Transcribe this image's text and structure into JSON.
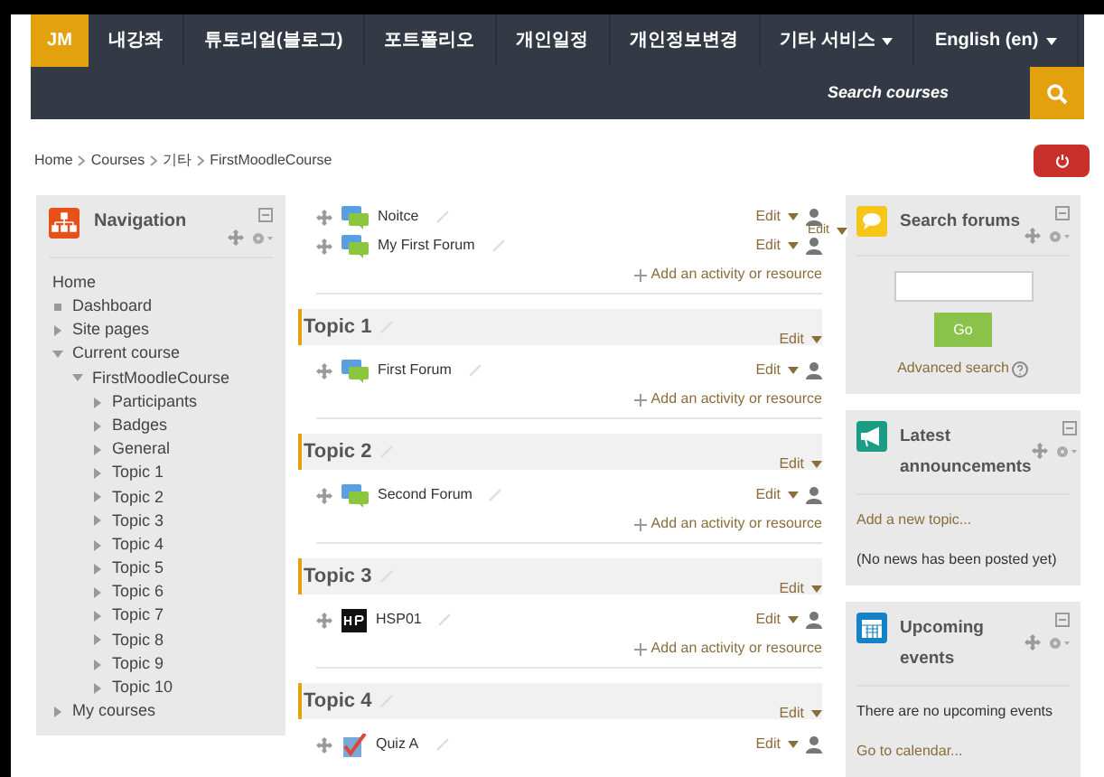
{
  "navbar": {
    "user_badge": "JM",
    "menu": [
      {
        "label": "내강좌",
        "dropdown": false
      },
      {
        "label": "튜토리얼(블로그)",
        "dropdown": false
      },
      {
        "label": "포트폴리오",
        "dropdown": false
      },
      {
        "label": "개인일정",
        "dropdown": false
      },
      {
        "label": "개인정보변경",
        "dropdown": false
      },
      {
        "label": "기타 서비스",
        "dropdown": true
      },
      {
        "label": "English (en)",
        "dropdown": true
      }
    ],
    "search": {
      "placeholder": "Search courses"
    }
  },
  "breadcrumb": [
    "Home",
    "Courses",
    "기타",
    "FirstMoodleCourse"
  ],
  "navigation": {
    "title": "Navigation",
    "tree": [
      {
        "label": "Home",
        "kind": "plain"
      },
      {
        "label": "Dashboard",
        "kind": "leaf"
      },
      {
        "label": "Site pages",
        "kind": "branch",
        "expanded": false
      },
      {
        "label": "Current course",
        "kind": "branch",
        "expanded": true,
        "children": [
          {
            "label": "FirstMoodleCourse",
            "kind": "branch",
            "expanded": true,
            "children": [
              {
                "label": "Participants",
                "kind": "branch",
                "expanded": false
              },
              {
                "label": "Badges",
                "kind": "branch",
                "expanded": false
              },
              {
                "label": "General",
                "kind": "branch",
                "expanded": false
              },
              {
                "label": "Topic 1",
                "kind": "branch",
                "expanded": false
              },
              {
                "label": "Topic 2",
                "kind": "branch",
                "expanded": false
              },
              {
                "label": "Topic 3",
                "kind": "branch",
                "expanded": false
              },
              {
                "label": "Topic 4",
                "kind": "branch",
                "expanded": false
              },
              {
                "label": "Topic 5",
                "kind": "branch",
                "expanded": false
              },
              {
                "label": "Topic 6",
                "kind": "branch",
                "expanded": false
              },
              {
                "label": "Topic 7",
                "kind": "branch",
                "expanded": false
              },
              {
                "label": "Topic 8",
                "kind": "branch",
                "expanded": false
              },
              {
                "label": "Topic 9",
                "kind": "branch",
                "expanded": false
              },
              {
                "label": "Topic 10",
                "kind": "branch",
                "expanded": false
              }
            ]
          }
        ]
      },
      {
        "label": "My courses",
        "kind": "branch",
        "expanded": false
      }
    ]
  },
  "sections": [
    {
      "edit": "Edit",
      "activities": [
        {
          "name": "Noitce",
          "kind": "forum",
          "edit": "Edit"
        },
        {
          "name": "My First Forum",
          "kind": "forum",
          "edit": "Edit"
        }
      ],
      "add": "Add an activity or resource"
    },
    {
      "title": "Topic 1",
      "edit": "Edit",
      "activities": [
        {
          "name": "First Forum",
          "kind": "forum",
          "edit": "Edit"
        }
      ],
      "add": "Add an activity or resource"
    },
    {
      "title": "Topic 2",
      "edit": "Edit",
      "activities": [
        {
          "name": "Second Forum",
          "kind": "forum",
          "edit": "Edit"
        }
      ],
      "add": "Add an activity or resource"
    },
    {
      "title": "Topic 3",
      "edit": "Edit",
      "activities": [
        {
          "name": "HSP01",
          "kind": "hvp",
          "edit": "Edit"
        }
      ],
      "add": "Add an activity or resource"
    },
    {
      "title": "Topic 4",
      "edit": "Edit",
      "activities": [
        {
          "name": "Quiz A",
          "kind": "quiz",
          "edit": "Edit"
        }
      ]
    }
  ],
  "blocks": [
    {
      "kind": "search",
      "title": "Search forums",
      "button": "Go",
      "link": "Advanced search"
    },
    {
      "kind": "news",
      "title": "Latest announcements",
      "link": "Add a new topic...",
      "text": "(No news has been posted yet)"
    },
    {
      "kind": "events",
      "title": "Upcoming events",
      "text": "There are no upcoming events",
      "link": "Go to calendar..."
    }
  ]
}
